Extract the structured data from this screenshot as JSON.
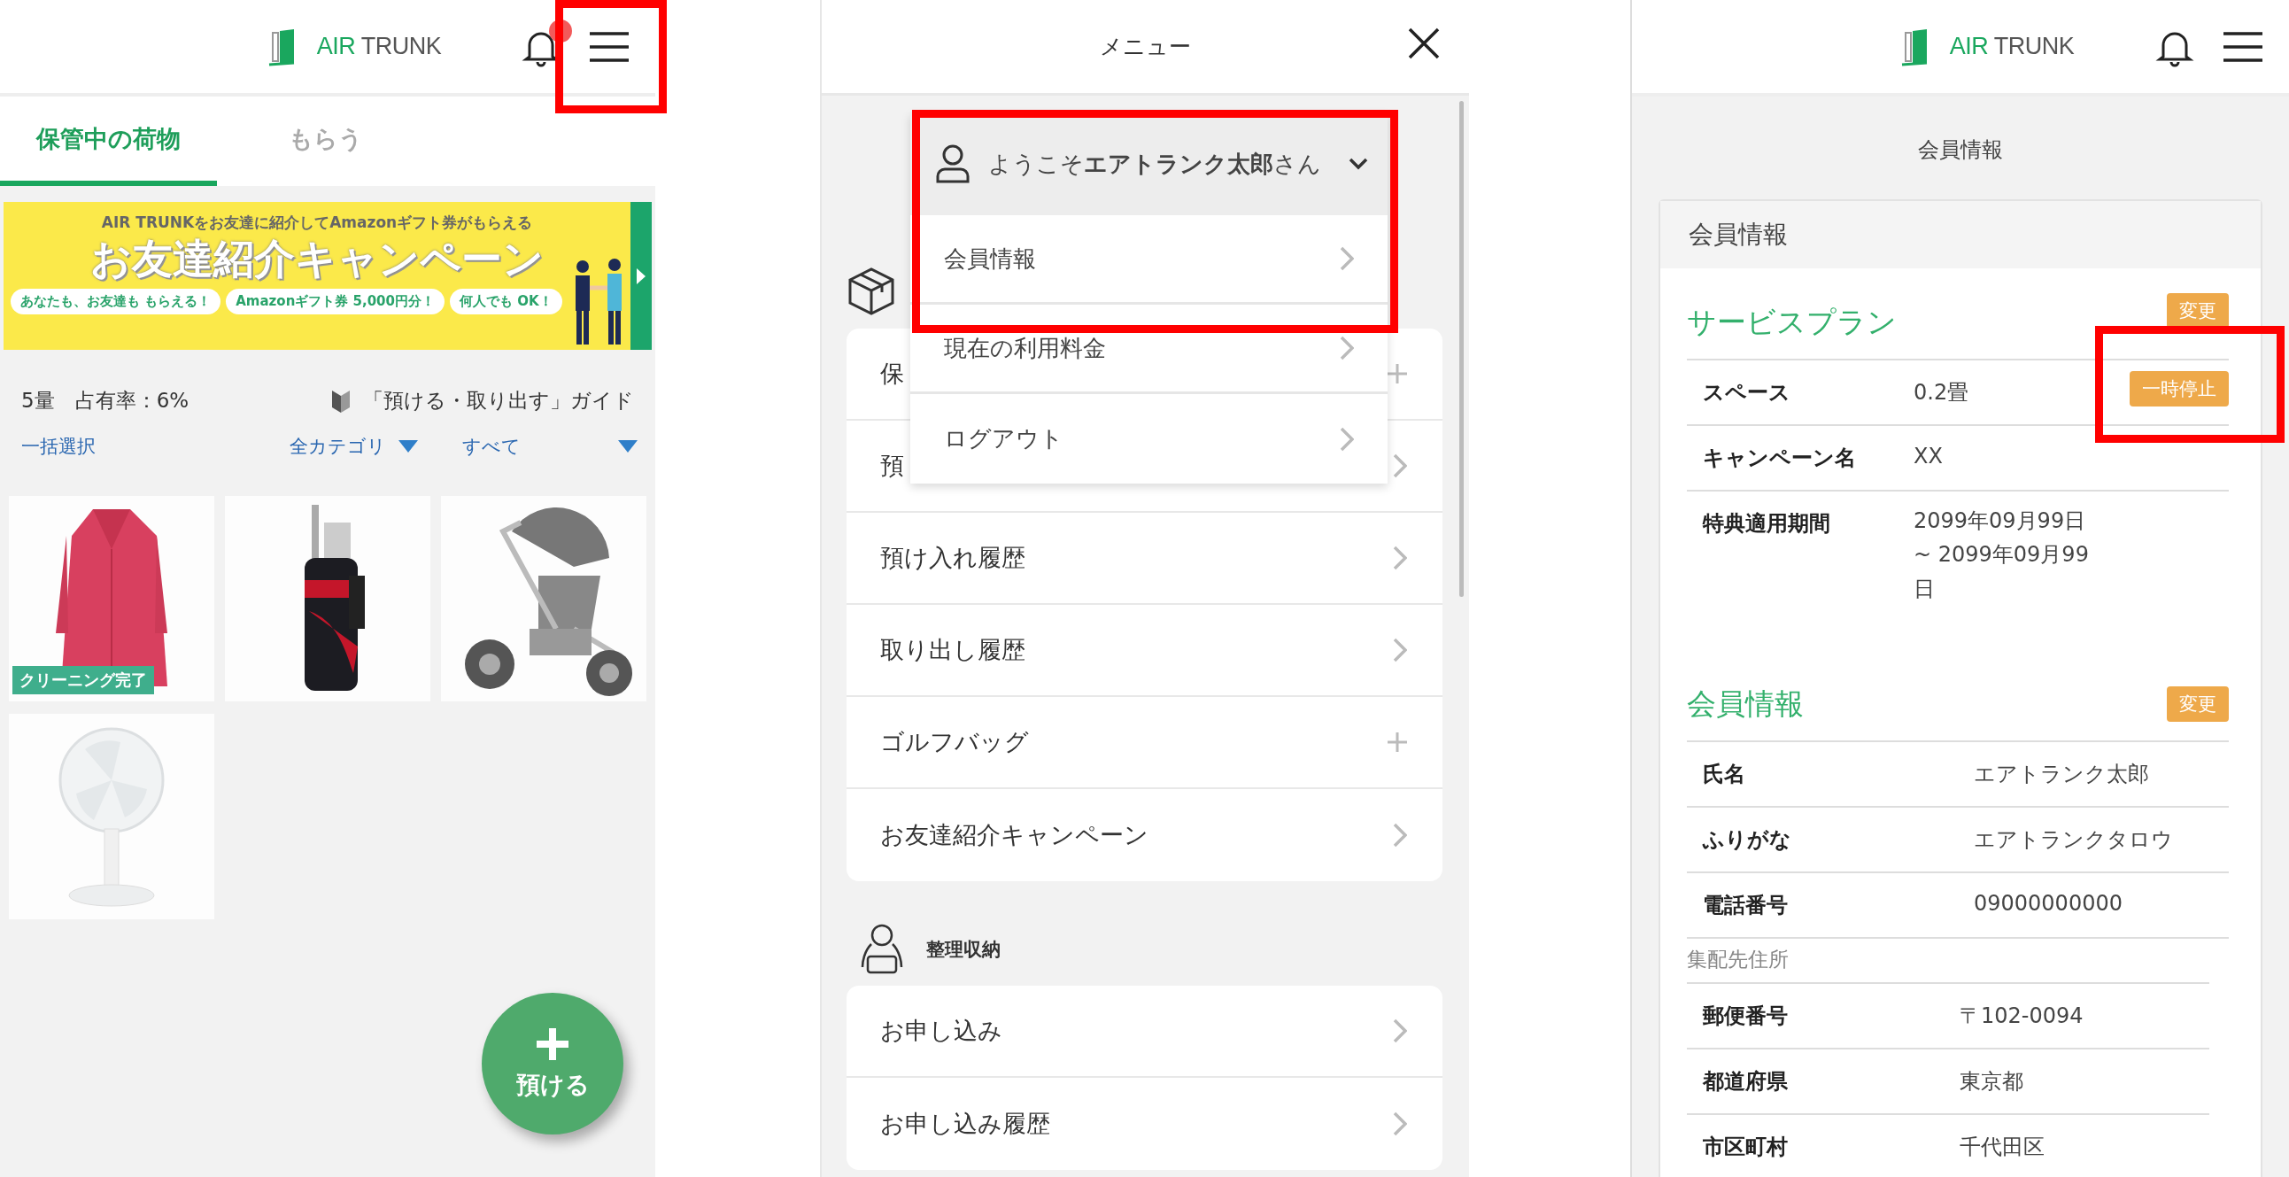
{
  "left_screen": {
    "header": {
      "logo": [
        "AIR",
        "TRUNK"
      ],
      "notification_dot": true
    },
    "tabs": [
      {
        "label": "保管中の荷物",
        "selected": true
      },
      {
        "label": "もらう",
        "selected": false
      }
    ],
    "banner": {
      "headline": "AIR TRUNKをお友達に紹介してAmazonギフト券がもらえる",
      "title": "お友達紹介キャンペーン",
      "pills": [
        "あなたも、お友達も もらえる！",
        "Amazonギフト券 5,000円分！",
        "何人でも OK！"
      ]
    },
    "usage": "5量　占有率：6%",
    "guide_link": "「預ける・取り出す」ガイド",
    "select_all": "一括選択",
    "filters": [
      "全カテゴリ",
      "すべて"
    ],
    "items": [
      {
        "kind": "picture",
        "badge": "クリーニング完了"
      },
      {
        "kind": "picture"
      },
      {
        "kind": "picture"
      },
      {
        "kind": "picture"
      }
    ],
    "fab_label": "預ける"
  },
  "menu_screen": {
    "title": "メニュー",
    "storage_items": [
      {
        "label": "保",
        "kind": "plus"
      },
      {
        "label": "預",
        "kind": "chevron"
      },
      {
        "label": "預け入れ履歴",
        "kind": "chevron"
      },
      {
        "label": "取り出し履歴",
        "kind": "chevron"
      },
      {
        "label": "ゴルフバッグ",
        "kind": "plus"
      },
      {
        "label": "お友達紹介キャンペーン",
        "kind": "chevron"
      }
    ],
    "organizing": {
      "label": "整理収納",
      "items": [
        {
          "label": "お申し込み",
          "kind": "chevron"
        },
        {
          "label": "お申し込み履歴",
          "kind": "chevron"
        }
      ]
    },
    "account_menu": {
      "welcome": "ようこそ**エアトランク太郎**さん",
      "expanded": true,
      "items": [
        "会員情報",
        "現在の利用料金",
        "ログアウト"
      ]
    }
  },
  "member_screen": {
    "header": {
      "logo": [
        "AIR",
        "TRUNK"
      ]
    },
    "page_title": "会員情報",
    "card_title": "会員情報",
    "sections": [
      {
        "title": "サービスプラン",
        "action": "変更",
        "rows": [
          {
            "label": "スペース",
            "value": "0.2畳",
            "action": "一時停止"
          },
          {
            "label": "キャンペーン名",
            "value": "XX"
          },
          {
            "label": "特典適用期間",
            "value": "2099年09月99日 ~ 2099年09月99日"
          }
        ]
      },
      {
        "title": "会員情報",
        "action": "変更",
        "rows": [
          {
            "label": "氏名",
            "value": "エアトランク太郎"
          },
          {
            "label": "ふりがな",
            "value": "エアトランクタロウ"
          },
          {
            "label": "電話番号",
            "value": "09000000000"
          }
        ],
        "subsection": {
          "label": "集配先住所",
          "rows": [
            {
              "label": "郵便番号",
              "value": "〒102-0094"
            },
            {
              "label": "都道府県",
              "value": "東京都"
            },
            {
              "label": "市区町村",
              "value": "千代田区"
            }
          ]
        }
      }
    ]
  }
}
